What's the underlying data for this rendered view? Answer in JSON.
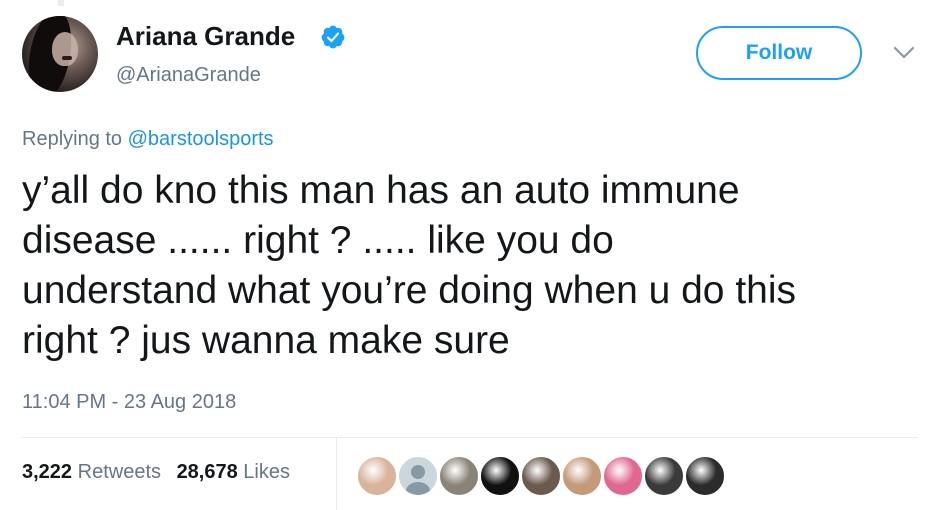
{
  "author": {
    "display_name": "Ariana Grande",
    "handle": "@ArianaGrande",
    "verified": true
  },
  "actions": {
    "follow_label": "Follow"
  },
  "reply": {
    "prefix": "Replying to ",
    "mention": "@barstoolsports"
  },
  "tweet": {
    "text_lines": [
      "y’all do kno this man has an auto immune",
      "disease ...... right ? ..... like you do",
      "understand what you’re doing when u do this",
      "right ? jus wanna make sure"
    ],
    "timestamp": "11:04 PM - 23 Aug 2018"
  },
  "stats": {
    "retweets_count": "3,222",
    "retweets_label": "Retweets",
    "likes_count": "28,678",
    "likes_label": "Likes"
  },
  "likers": [
    {
      "name": "liker-avatar-1",
      "color": "#d8b49c"
    },
    {
      "name": "liker-avatar-2-default",
      "color": "#ccd6dd"
    },
    {
      "name": "liker-avatar-3",
      "color": "#8a8478"
    },
    {
      "name": "liker-avatar-4",
      "color": "#111111"
    },
    {
      "name": "liker-avatar-5",
      "color": "#6b5a4e"
    },
    {
      "name": "liker-avatar-6",
      "color": "#c49a78"
    },
    {
      "name": "liker-avatar-7",
      "color": "#e0678f"
    },
    {
      "name": "liker-avatar-8",
      "color": "#3a3a3a"
    },
    {
      "name": "liker-avatar-9",
      "color": "#2b2b2b"
    }
  ],
  "colors": {
    "accent": "#1da1f2",
    "link": "#1b95e0",
    "secondary_text": "#657786",
    "primary_text": "#14171a",
    "divider": "#e6ecf0"
  },
  "icons": {
    "verified": "verified-badge-icon",
    "menu": "chevron-down-icon"
  }
}
